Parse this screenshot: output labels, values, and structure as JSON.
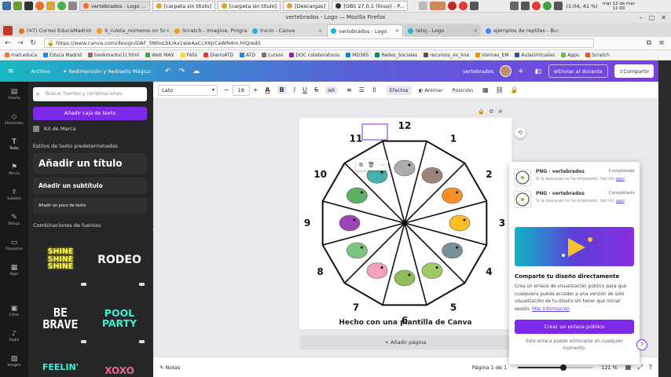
{
  "os": {
    "tasks": [
      {
        "label": "vertebrados - Logo ...",
        "active": true
      },
      {
        "label": "[carpeta sin título]",
        "active": false
      },
      {
        "label": "[carpeta sin título]",
        "active": false
      },
      {
        "label": "[Descargas]",
        "active": false
      },
      {
        "label": "[OBS 27.0.1 (linux) - P...",
        "active": false
      }
    ],
    "battery": "(1:04, 41 %)",
    "clock": "mar 12 de mar",
    "clock2": "11:00"
  },
  "window": {
    "title": "vertebrados - Logo — Mozilla Firefox"
  },
  "tabs": [
    {
      "label": "(47) Correo EducaMadrid",
      "active": false,
      "color": "#e07a2b"
    },
    {
      "label": "9_ruleta_números on Sc",
      "active": false,
      "color": "#f0a020"
    },
    {
      "label": "Scratch - Imagine, Progra",
      "active": false,
      "color": "#f0a020"
    },
    {
      "label": "Inicio - Canva",
      "active": false,
      "color": "#20b5c8"
    },
    {
      "label": "vertebrados - Logo",
      "active": true,
      "color": "#20b5c8"
    },
    {
      "label": "reloj - Logo",
      "active": false,
      "color": "#20b5c8"
    },
    {
      "label": "ejemplos de reptiles - Bu",
      "active": false,
      "color": "#4285f4"
    }
  ],
  "url": "https://www.canva.com/design/DAF_SN0nLbk/Ax1wwAaCcX6JrCeWN4m.HiQ/edit",
  "bookmarks": [
    "mail.educa",
    "Educa Madrid",
    "bookmarks(1).html",
    "Web MAX",
    "Félix",
    "DiarioATD",
    "ATD",
    "cursos",
    "DOC colaborativos",
    "MD365",
    "Redes_Sociales",
    "recursos_on_line",
    "Viernes_EM",
    "AulasVirtuales",
    "Apps",
    "Scratch"
  ],
  "canva_header": {
    "file": "Archivo",
    "resize": "Redimensión y Rediseño Mágico",
    "design_name": "vertebrados",
    "print": "Enviar al docente",
    "share": "Compartir"
  },
  "rail": [
    "Diseño",
    "Elementos",
    "Texto",
    "Marca",
    "Subidos",
    "Dibujo",
    "Proyectos",
    "Apps",
    "Fotos",
    "Audio",
    "Imagen"
  ],
  "rail_icons": [
    "layout-icon",
    "elements-icon",
    "text-icon",
    "brand-icon",
    "upload-icon",
    "draw-icon",
    "folder-icon",
    "apps-icon",
    "photo-icon",
    "audio-icon",
    "image-icon"
  ],
  "panel": {
    "search_placeholder": "Buscar fuentes y combinaciones",
    "add_text": "Añadir caja de texto",
    "brand_kit": "Kit de Marca",
    "default_styles": "Estilos de texto predeterminados",
    "title": "Añadir un título",
    "subtitle": "Añadir un subtítulo",
    "body": "Añadir un poco de texto",
    "combos_heading": "Combinaciones de fuentes",
    "combos": [
      "SHINE SHINE SHINE",
      "RODEO",
      "BE BRAVE",
      "POOL PARTY",
      "FEELIN'",
      "XOXO"
    ]
  },
  "toolbar": {
    "font": "Lato",
    "size": "19",
    "effects": "Efectos",
    "animate": "Animar",
    "position": "Posición"
  },
  "wheel": {
    "numbers": [
      "1",
      "2",
      "3",
      "4",
      "5",
      "6",
      "7",
      "8",
      "9",
      "10",
      "11",
      "12"
    ],
    "caption": "Hecho con una plantilla de Canva"
  },
  "add_page": "+ Añadir página",
  "status": {
    "notes": "Notas",
    "page": "Página 1 de 1",
    "zoom": "121 %",
    "zoom_level": 0.6
  },
  "share_panel": {
    "downloads": [
      {
        "title": "PNG · vertebrados",
        "status": "Completado",
        "sub": "Si la descarga no ha empezado, haz clic",
        "link": "aquí"
      },
      {
        "title": "PNG · vertebrados",
        "status": "Completado",
        "sub": "Si la descarga no ha empezado, haz clic",
        "link": "aquí"
      }
    ],
    "heading": "Comparte tu diseño directamente",
    "desc": "Crea un enlace de visualización público para que cualquiera pueda acceder a una versión de solo visualización de tu diseño sin tener que iniciar sesión.",
    "more": "Más información",
    "button": "Crear un enlace público",
    "note": "Este enlace puede eliminarse en cualquier momento."
  },
  "colors": {
    "accent": "#7d2ae8",
    "teal": "#18b8c4"
  }
}
